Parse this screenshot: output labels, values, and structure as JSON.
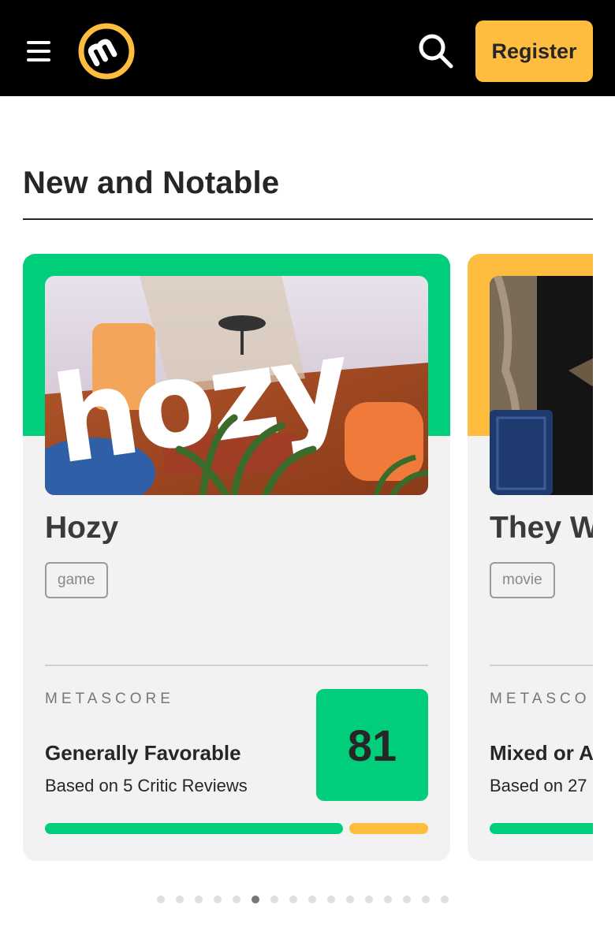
{
  "header": {
    "menu_icon": "hamburger-menu-icon",
    "logo_icon": "metacritic-logo",
    "search_icon": "search-icon",
    "register_label": "Register",
    "brand_color": "#ffbd3f"
  },
  "section": {
    "title": "New and Notable"
  },
  "cards": [
    {
      "title": "Hozy",
      "tag": "game",
      "band_color": "#00ce7a",
      "image_text": "hozy",
      "metascore_label": "METASCORE",
      "verdict": "Generally Favorable",
      "based_on": "Based on 5 Critic Reviews",
      "score": "81",
      "score_color": "#00ce7a",
      "distribution": {
        "positive_fraction": 0.79,
        "mixed_fraction": 0.21,
        "positive_color": "#00ce7a",
        "mixed_color": "#ffbd3f"
      }
    },
    {
      "title": "They W",
      "tag": "movie",
      "band_color": "#ffbd3f",
      "metascore_label": "METASCO",
      "verdict": "Mixed or A",
      "based_on": "Based on 27",
      "distribution": {
        "positive_color": "#00ce7a"
      }
    }
  ],
  "pagination": {
    "count": 16,
    "active_index": 5
  }
}
